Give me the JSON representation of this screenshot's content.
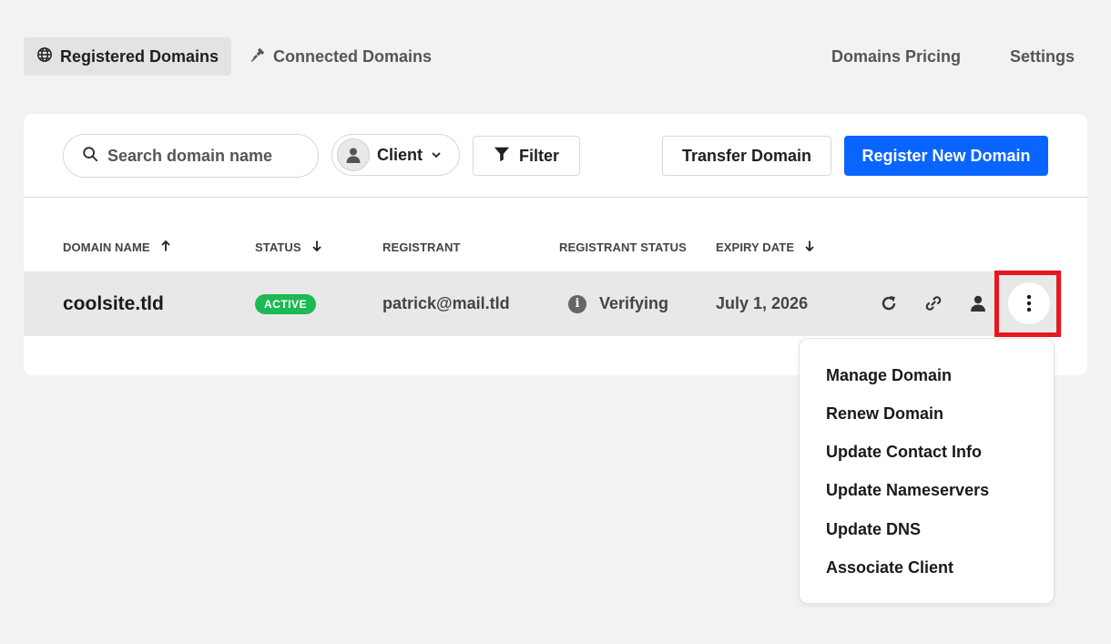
{
  "nav": {
    "tabs": [
      {
        "label": "Registered Domains",
        "icon": "globe-icon",
        "active": true
      },
      {
        "label": "Connected Domains",
        "icon": "plug-icon",
        "active": false
      }
    ],
    "links": [
      "Domains Pricing",
      "Settings"
    ]
  },
  "toolbar": {
    "search_placeholder": "Search domain name",
    "client_label": "Client",
    "filter_label": "Filter",
    "transfer_label": "Transfer Domain",
    "register_label": "Register New Domain"
  },
  "table": {
    "headers": {
      "domain": "DOMAIN NAME",
      "status": "STATUS",
      "registrant": "REGISTRANT",
      "registrant_status": "REGISTRANT STATUS",
      "expiry": "EXPIRY DATE"
    },
    "rows": [
      {
        "domain": "coolsite.tld",
        "status": "ACTIVE",
        "registrant": "patrick@mail.tld",
        "registrant_status": "Verifying",
        "expiry": "July 1, 2026"
      }
    ]
  },
  "menu": {
    "items": [
      "Manage Domain",
      "Renew Domain",
      "Update Contact Info",
      "Update Nameservers",
      "Update DNS",
      "Associate Client"
    ]
  },
  "colors": {
    "primary": "#0a64ff",
    "active_badge": "#1db954",
    "highlight": "#e8161f",
    "background": "#f2f2f2"
  }
}
